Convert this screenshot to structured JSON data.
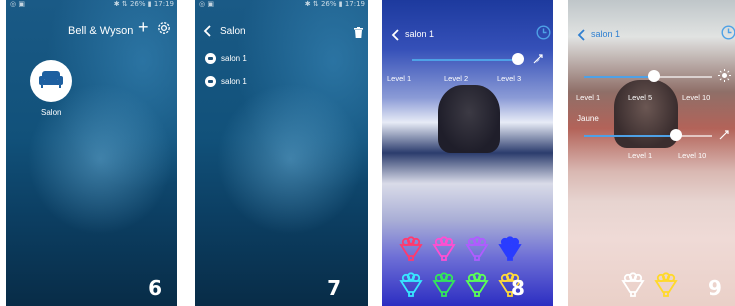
{
  "screens": [
    {
      "status_left": "◎ ▣",
      "status_right": "✱ ⇅ 26% ▮ 17:19",
      "header_title": "Bell & Wyson",
      "add_symbol": "+",
      "room_label": "Salon",
      "step_number": "6"
    },
    {
      "status_left": "◎ ▣",
      "status_right": "✱ ⇅ 26% ▮ 17:19",
      "title": "Salon",
      "devices": [
        "salon 1",
        "salon 1"
      ],
      "step_number": "7"
    },
    {
      "title": "salon 1",
      "levels": [
        "Level 1",
        "Level 2",
        "Level 3"
      ],
      "slider_value_pct": 93,
      "step_number": "8"
    },
    {
      "title": "salon 1",
      "row1_levels": [
        "Level 1",
        "Level 5",
        "Level 10"
      ],
      "row2_label": "Jaune",
      "row2_levels": [
        "Level 1",
        "Level 10"
      ],
      "slider1_value_pct": 65,
      "slider2_value_pct": 84,
      "step_number": "9"
    }
  ],
  "colors": {
    "accent_blue": "#4ea1e6",
    "bulbs_screen8": [
      "#ff3a6e",
      "#ff4fd2",
      "#b05cff",
      "#2a3cff",
      "#37e6ff",
      "#33e65a",
      "#5bff56",
      "#ffd93a"
    ],
    "bulbs_screen9": [
      "#ffffff",
      "#ffd92a"
    ]
  }
}
